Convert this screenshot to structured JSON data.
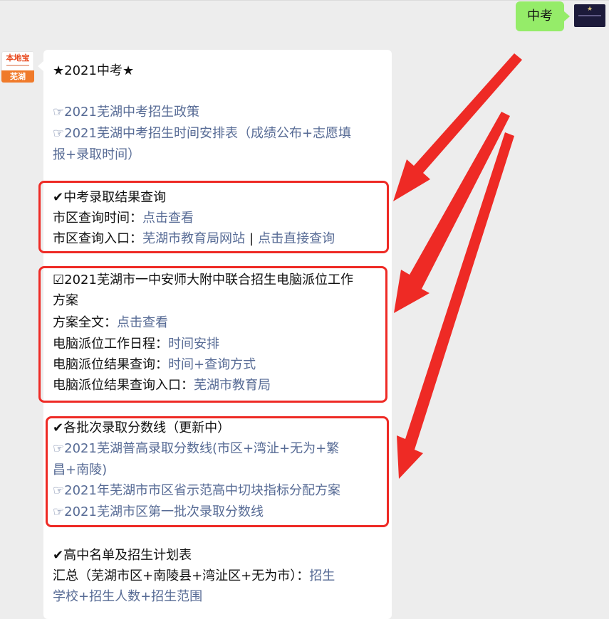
{
  "outgoing": {
    "text": "中考"
  },
  "bot": {
    "brand": "本地宝",
    "city": "芜湖"
  },
  "message": {
    "title": "★2021中考★",
    "links_top": [
      {
        "prefix": "☞",
        "text": "2021芜湖中考招生政策"
      },
      {
        "prefix": "☞",
        "text": "2021芜湖中考招生时间安排表（成绩公布+志愿填"
      },
      {
        "text": "报+录取时间）"
      }
    ],
    "section1": {
      "heading": "✔中考录取结果查询",
      "row1_label": "市区查询时间：",
      "row1_link": "点击查看",
      "row2_label": "市区查询入口：",
      "row2_link_a": "芜湖市教育局网站",
      "row2_sep": "|",
      "row2_link_b": "点击直接查询"
    },
    "section2": {
      "heading_line1": "☑2021芜湖市一中安师大附中联合招生电脑派位工作",
      "heading_line2": "方案",
      "rows": [
        {
          "label": "方案全文：",
          "link": "点击查看"
        },
        {
          "label": "电脑派位工作日程：",
          "link": "时间安排"
        },
        {
          "label": "电脑派位结果查询：",
          "link": "时间+查询方式"
        },
        {
          "label": "电脑派位结果查询入口：",
          "link": "芜湖市教育局"
        }
      ]
    },
    "section3": {
      "heading": "✔各批次录取分数线（更新中）",
      "links": [
        {
          "prefix": "☞",
          "text": "2021芜湖普高录取分数线(市区+湾沚+无为+繁"
        },
        {
          "text": "昌+南陵)"
        },
        {
          "prefix": "☞",
          "text": "2021年芜湖市市区省示范高中切块指标分配方案"
        },
        {
          "prefix": "☞",
          "text": "2021芜湖市区第一批次录取分数线"
        }
      ]
    },
    "section4": {
      "heading": "✔高中名单及招生计划表",
      "summary_label": "汇总（芜湖市区+南陵县+湾沚区+无为市）：",
      "summary_link_a": "招生",
      "summary_link_b": "学校+招生人数+招生范围"
    }
  },
  "colors": {
    "link": "#576b95",
    "highlight": "#ee2a25",
    "outgoing_bubble": "#95ec69",
    "background": "#ededed"
  }
}
